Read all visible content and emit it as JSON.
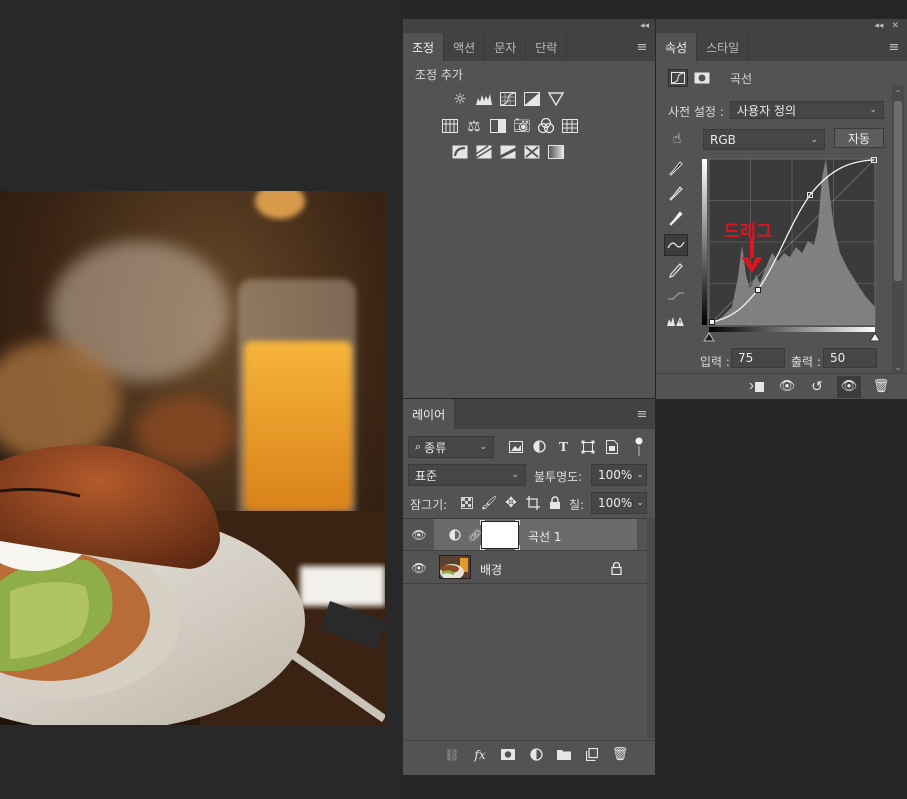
{
  "adjustments_panel": {
    "tabs": [
      "조정",
      "액션",
      "문자",
      "단락"
    ],
    "title": "조정 추가",
    "icons_row1": [
      "brightness-contrast-icon",
      "levels-icon",
      "curves-icon",
      "exposure-icon",
      "vibrance-icon"
    ],
    "icons_row2": [
      "hue-saturation-icon",
      "color-balance-icon",
      "black-white-icon",
      "photo-filter-icon",
      "channel-mixer-icon",
      "color-lookup-icon"
    ],
    "icons_row3": [
      "invert-icon",
      "posterize-icon",
      "threshold-icon",
      "selective-color-icon",
      "gradient-map-icon"
    ]
  },
  "properties_panel": {
    "tabs": [
      "속성",
      "스타일"
    ],
    "header_label": "곡선",
    "preset_label": "사전 설정 :",
    "preset_value": "사용자 정의",
    "channel_value": "RGB",
    "auto_button": "자동",
    "annotation": "드래그",
    "input_label": "입력 :",
    "input_value": "75",
    "output_label": "출력 :",
    "output_value": "50"
  },
  "layers_panel": {
    "tab": "레이어",
    "filter_kind": "종류",
    "blend_mode": "표준",
    "opacity_label": "불투명도:",
    "opacity_value": "100%",
    "lock_label": "잠그기:",
    "fill_label": "칠:",
    "fill_value": "100%",
    "layers": [
      {
        "name": "곡선 1",
        "selected": true
      },
      {
        "name": "배경",
        "selected": false
      }
    ]
  },
  "colors": {
    "panel_bg": "#535353",
    "annotation_red": "#e0141e"
  }
}
